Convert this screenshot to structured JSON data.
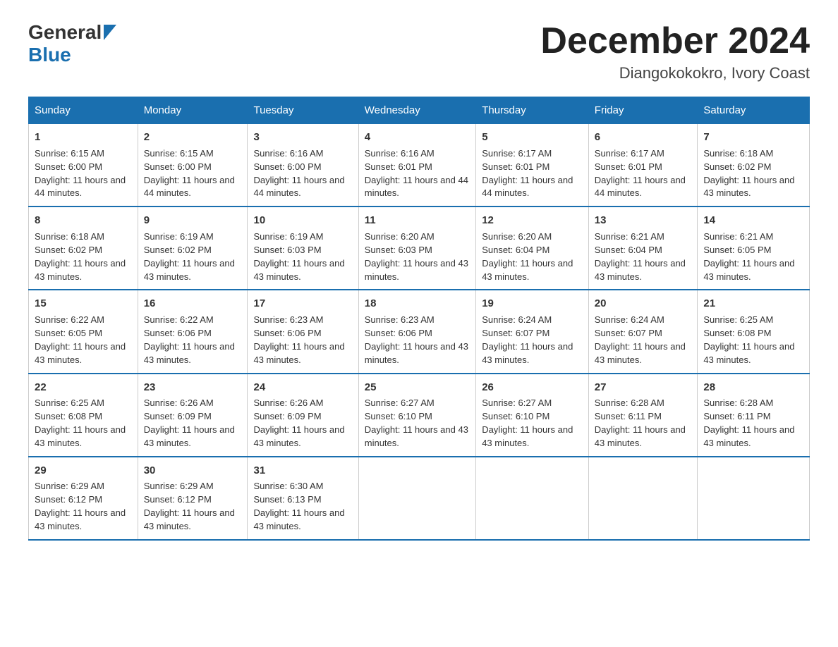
{
  "logo": {
    "text_general": "General",
    "text_blue": "Blue"
  },
  "title": "December 2024",
  "subtitle": "Diangokokokro, Ivory Coast",
  "days_of_week": [
    "Sunday",
    "Monday",
    "Tuesday",
    "Wednesday",
    "Thursday",
    "Friday",
    "Saturday"
  ],
  "weeks": [
    [
      {
        "day": "1",
        "sunrise": "6:15 AM",
        "sunset": "6:00 PM",
        "daylight": "11 hours and 44 minutes."
      },
      {
        "day": "2",
        "sunrise": "6:15 AM",
        "sunset": "6:00 PM",
        "daylight": "11 hours and 44 minutes."
      },
      {
        "day": "3",
        "sunrise": "6:16 AM",
        "sunset": "6:00 PM",
        "daylight": "11 hours and 44 minutes."
      },
      {
        "day": "4",
        "sunrise": "6:16 AM",
        "sunset": "6:01 PM",
        "daylight": "11 hours and 44 minutes."
      },
      {
        "day": "5",
        "sunrise": "6:17 AM",
        "sunset": "6:01 PM",
        "daylight": "11 hours and 44 minutes."
      },
      {
        "day": "6",
        "sunrise": "6:17 AM",
        "sunset": "6:01 PM",
        "daylight": "11 hours and 44 minutes."
      },
      {
        "day": "7",
        "sunrise": "6:18 AM",
        "sunset": "6:02 PM",
        "daylight": "11 hours and 43 minutes."
      }
    ],
    [
      {
        "day": "8",
        "sunrise": "6:18 AM",
        "sunset": "6:02 PM",
        "daylight": "11 hours and 43 minutes."
      },
      {
        "day": "9",
        "sunrise": "6:19 AM",
        "sunset": "6:02 PM",
        "daylight": "11 hours and 43 minutes."
      },
      {
        "day": "10",
        "sunrise": "6:19 AM",
        "sunset": "6:03 PM",
        "daylight": "11 hours and 43 minutes."
      },
      {
        "day": "11",
        "sunrise": "6:20 AM",
        "sunset": "6:03 PM",
        "daylight": "11 hours and 43 minutes."
      },
      {
        "day": "12",
        "sunrise": "6:20 AM",
        "sunset": "6:04 PM",
        "daylight": "11 hours and 43 minutes."
      },
      {
        "day": "13",
        "sunrise": "6:21 AM",
        "sunset": "6:04 PM",
        "daylight": "11 hours and 43 minutes."
      },
      {
        "day": "14",
        "sunrise": "6:21 AM",
        "sunset": "6:05 PM",
        "daylight": "11 hours and 43 minutes."
      }
    ],
    [
      {
        "day": "15",
        "sunrise": "6:22 AM",
        "sunset": "6:05 PM",
        "daylight": "11 hours and 43 minutes."
      },
      {
        "day": "16",
        "sunrise": "6:22 AM",
        "sunset": "6:06 PM",
        "daylight": "11 hours and 43 minutes."
      },
      {
        "day": "17",
        "sunrise": "6:23 AM",
        "sunset": "6:06 PM",
        "daylight": "11 hours and 43 minutes."
      },
      {
        "day": "18",
        "sunrise": "6:23 AM",
        "sunset": "6:06 PM",
        "daylight": "11 hours and 43 minutes."
      },
      {
        "day": "19",
        "sunrise": "6:24 AM",
        "sunset": "6:07 PM",
        "daylight": "11 hours and 43 minutes."
      },
      {
        "day": "20",
        "sunrise": "6:24 AM",
        "sunset": "6:07 PM",
        "daylight": "11 hours and 43 minutes."
      },
      {
        "day": "21",
        "sunrise": "6:25 AM",
        "sunset": "6:08 PM",
        "daylight": "11 hours and 43 minutes."
      }
    ],
    [
      {
        "day": "22",
        "sunrise": "6:25 AM",
        "sunset": "6:08 PM",
        "daylight": "11 hours and 43 minutes."
      },
      {
        "day": "23",
        "sunrise": "6:26 AM",
        "sunset": "6:09 PM",
        "daylight": "11 hours and 43 minutes."
      },
      {
        "day": "24",
        "sunrise": "6:26 AM",
        "sunset": "6:09 PM",
        "daylight": "11 hours and 43 minutes."
      },
      {
        "day": "25",
        "sunrise": "6:27 AM",
        "sunset": "6:10 PM",
        "daylight": "11 hours and 43 minutes."
      },
      {
        "day": "26",
        "sunrise": "6:27 AM",
        "sunset": "6:10 PM",
        "daylight": "11 hours and 43 minutes."
      },
      {
        "day": "27",
        "sunrise": "6:28 AM",
        "sunset": "6:11 PM",
        "daylight": "11 hours and 43 minutes."
      },
      {
        "day": "28",
        "sunrise": "6:28 AM",
        "sunset": "6:11 PM",
        "daylight": "11 hours and 43 minutes."
      }
    ],
    [
      {
        "day": "29",
        "sunrise": "6:29 AM",
        "sunset": "6:12 PM",
        "daylight": "11 hours and 43 minutes."
      },
      {
        "day": "30",
        "sunrise": "6:29 AM",
        "sunset": "6:12 PM",
        "daylight": "11 hours and 43 minutes."
      },
      {
        "day": "31",
        "sunrise": "6:30 AM",
        "sunset": "6:13 PM",
        "daylight": "11 hours and 43 minutes."
      },
      null,
      null,
      null,
      null
    ]
  ]
}
